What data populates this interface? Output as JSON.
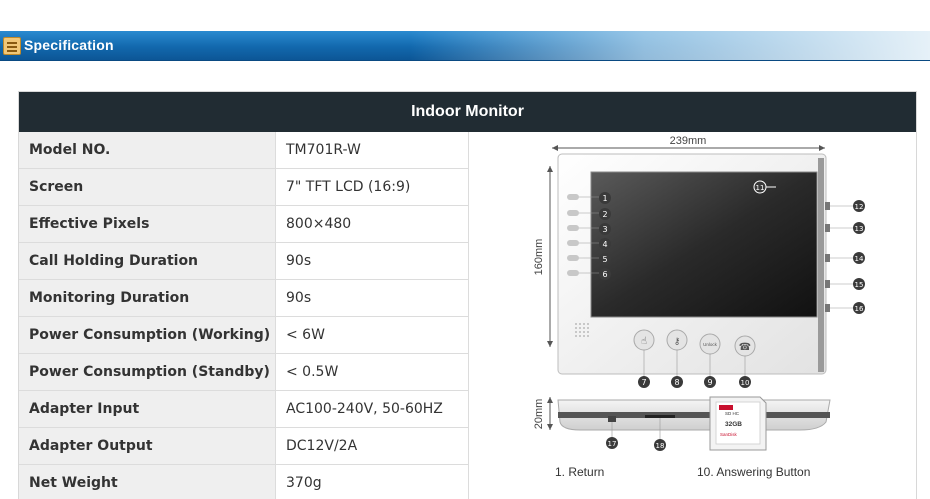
{
  "header": {
    "title": "Specification",
    "icon": "document-list-icon"
  },
  "table": {
    "title": "Indoor Monitor",
    "rows": [
      {
        "label": "Model NO.",
        "value": "TM701R-W"
      },
      {
        "label": "Screen",
        "value": "7\" TFT LCD (16:9)"
      },
      {
        "label": "Effective Pixels",
        "value": "800×480"
      },
      {
        "label": "Call Holding Duration",
        "value": "90s"
      },
      {
        "label": "Monitoring Duration",
        "value": "90s"
      },
      {
        "label": "Power Consumption (Working)",
        "value": "< 6W"
      },
      {
        "label": "Power Consumption (Standby)",
        "value": "< 0.5W"
      },
      {
        "label": "Adapter Input",
        "value": "AC100-240V, 50-60HZ"
      },
      {
        "label": "Adapter Output",
        "value": "DC12V/2A"
      },
      {
        "label": "Net Weight",
        "value": "370g"
      }
    ]
  },
  "figure": {
    "width_dim": "239mm",
    "height_dim": "160mm",
    "depth_dim": "20mm",
    "front_numbers": [
      "1",
      "2",
      "3",
      "4",
      "5",
      "6"
    ],
    "bottom_numbers": [
      "7",
      "8",
      "9",
      "10"
    ],
    "screen_number": "11",
    "side_numbers": [
      "12",
      "13",
      "14",
      "15",
      "16"
    ],
    "base_numbers": [
      "17",
      "18"
    ],
    "unlock_button_text": "Unlock",
    "sd_card": {
      "brand": "SanDisk",
      "capacity": "32GB",
      "type": "SD HC"
    },
    "legend": [
      "1. Return",
      "10. Answering Button"
    ]
  }
}
